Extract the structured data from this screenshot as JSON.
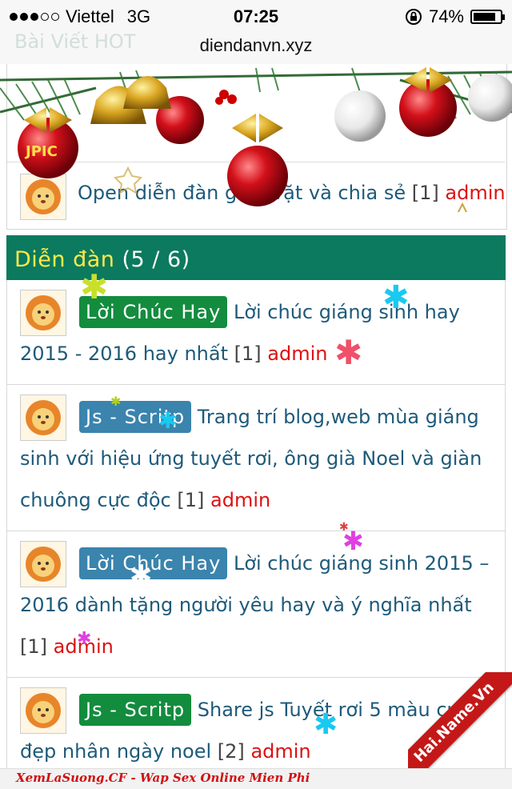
{
  "status_bar": {
    "carrier": "Viettel",
    "network": "3G",
    "time": "07:25",
    "battery": "74%",
    "signal_bars_filled": 3,
    "signal_bars_total": 5
  },
  "browser": {
    "url": "diendanvn.xyz"
  },
  "hot_posts": {
    "ghost_title": "Bài Viết HOT",
    "last_item": {
      "title": "Open diễn đàn giao vặt và chia sẻ",
      "count": "[1]",
      "author": "admin"
    }
  },
  "forum": {
    "title": "Diễn đàn",
    "page": "(5 / 6)",
    "posts": [
      {
        "tag": "Lời Chúc Hay",
        "title": "Lời chúc giáng sinh hay 2015 - 2016 hay nhất",
        "count": "[1]",
        "author": "admin"
      },
      {
        "tag": "Js - Scritp",
        "title": "Trang trí blog,web mùa giáng sinh với hiệu ứng tuyết rơi, ông già Noel và giàn chuông cực độc",
        "count": "[1]",
        "author": "admin"
      },
      {
        "tag": "Lời Chúc Hay",
        "title": "Lời chúc giáng sinh 2015 – 2016 dành tặng người yêu hay và ý nghĩa nhất",
        "count": "[1]",
        "author": "admin"
      },
      {
        "tag": "Js - Scritp",
        "title": "Share js Tuyết rơi 5 màu cực đẹp nhân ngày noel",
        "count": "[2]",
        "author": "admin"
      }
    ]
  },
  "footer_ad": "XemLaSuong.CF - Wap Sex Online Mien Phi",
  "ribbon": "Hai.Name.Vn",
  "colors": {
    "forum_header_bg": "#0b7a5e",
    "forum_header_text": "#ffe94a",
    "link": "#1e5a7a",
    "author": "#dd1111",
    "tag_green": "#138c3e",
    "tag_blue": "#3a84ad"
  }
}
